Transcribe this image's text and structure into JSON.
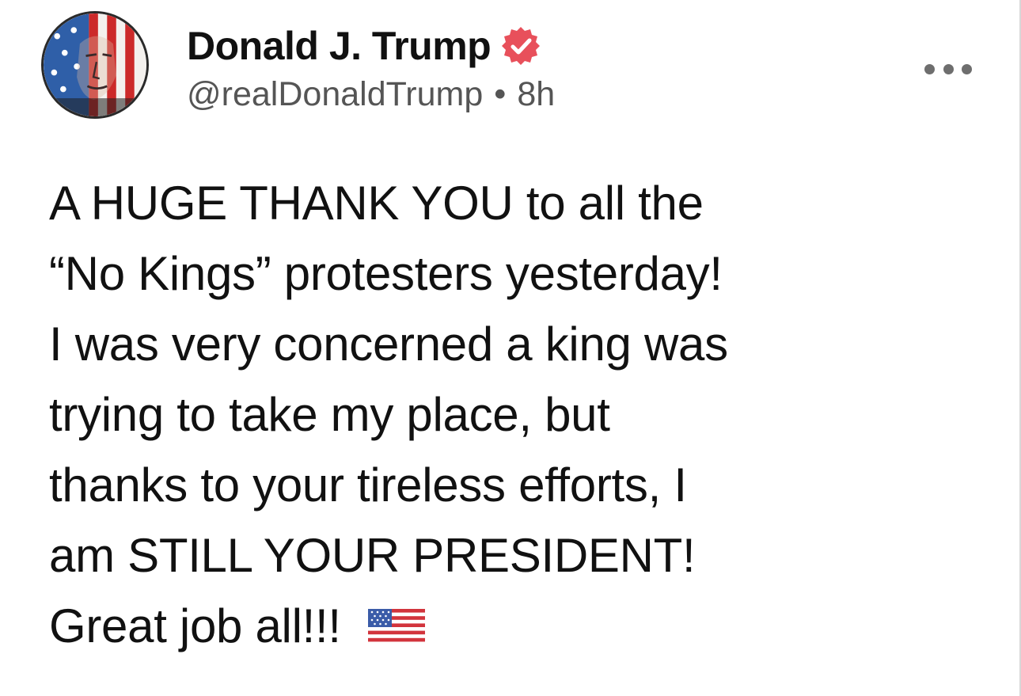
{
  "author": {
    "display_name": "Donald J. Trump",
    "handle": "@realDonaldTrump",
    "separator": "•",
    "timestamp": "8h",
    "verified": true,
    "avatar_icon": "flag-face-avatar-icon",
    "verified_icon": "verified-badge-icon"
  },
  "post": {
    "lines": [
      "A HUGE THANK YOU to all the",
      "“No Kings” protesters yesterday!",
      "I was very concerned a king was",
      "trying to take my place, but",
      "thanks to your tireless efforts, I",
      "am STILL YOUR PRESIDENT!",
      "Great job all!!!"
    ],
    "trailing_emoji": "us-flag-icon"
  },
  "actions": {
    "more_icon": "more-options-icon"
  },
  "colors": {
    "verified_badge": "#e8505b",
    "text": "#111111",
    "secondary_text": "#555555",
    "more_dots": "#6e6e6e",
    "background": "#ffffff"
  }
}
